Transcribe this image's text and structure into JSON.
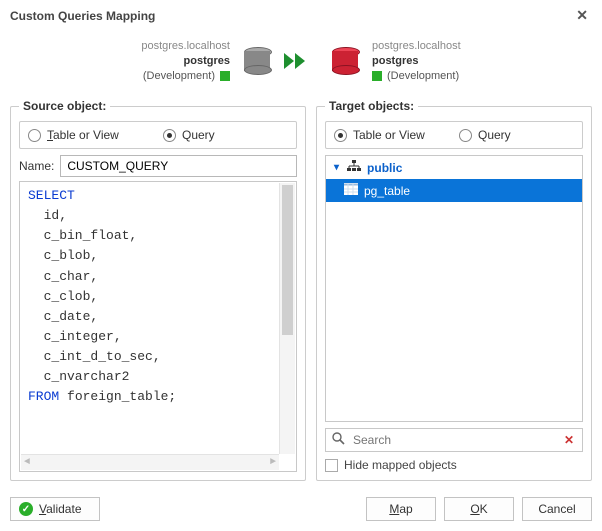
{
  "title": "Custom Queries Mapping",
  "connections": {
    "source": {
      "host": "postgres.localhost",
      "db": "postgres",
      "env": "(Development)"
    },
    "target": {
      "host": "postgres.localhost",
      "db": "postgres",
      "env": "(Development)"
    }
  },
  "source_panel": {
    "legend": "Source object:",
    "radio": {
      "table_view": "Table or View",
      "query": "Query",
      "selected": "query"
    },
    "name_label": "Name:",
    "name_value": "CUSTOM_QUERY",
    "sql": {
      "kw_select": "SELECT",
      "cols": [
        "id",
        "c_bin_float",
        "c_blob",
        "c_char",
        "c_clob",
        "c_date",
        "c_integer",
        "c_int_d_to_sec",
        "c_nvarchar2"
      ],
      "kw_from": "FROM",
      "table": "foreign_table"
    }
  },
  "target_panel": {
    "legend": "Target objects:",
    "radio": {
      "table_view": "Table or View",
      "query": "Query",
      "selected": "table_view"
    },
    "schema": "public",
    "item": "pg_table",
    "search_placeholder": "Search",
    "hide_label": "Hide mapped objects"
  },
  "footer": {
    "validate": "Validate",
    "map": "Map",
    "ok": "OK",
    "cancel": "Cancel"
  }
}
